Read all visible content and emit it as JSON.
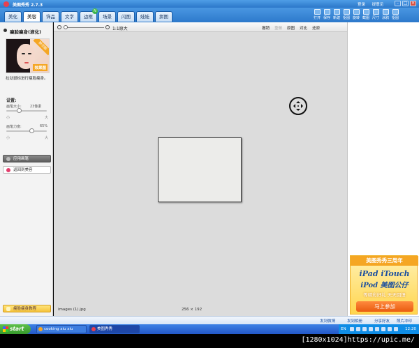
{
  "app": {
    "title": "美图秀秀 2.7.3",
    "links": [
      "登录",
      "提意见"
    ]
  },
  "tabs": [
    {
      "label": "美化"
    },
    {
      "label": "美容",
      "active": true
    },
    {
      "label": "饰品"
    },
    {
      "label": "文字"
    },
    {
      "label": "边框",
      "badge": "N"
    },
    {
      "label": "场景"
    },
    {
      "label": "闪图"
    },
    {
      "label": "娃娃"
    },
    {
      "label": "拼图"
    }
  ],
  "tools": [
    {
      "label": "打开"
    },
    {
      "label": "保存"
    },
    {
      "label": "新建"
    },
    {
      "label": "抠图"
    },
    {
      "label": "旋转"
    },
    {
      "label": "截图"
    },
    {
      "label": "尺寸"
    },
    {
      "label": "涂鸦"
    },
    {
      "label": "抠图"
    }
  ],
  "panel": {
    "title": "瘦脸瘦身(液化)",
    "thumb_corner": "新功能",
    "thumb_label": "效果图",
    "hint": "拉动鼠标进行瘦脸瘦身。",
    "settings_label": "设置:",
    "brush_size": {
      "label": "画笔大小:",
      "value": "23像素",
      "min": "小",
      "max": "大",
      "level": 0.3
    },
    "brush_force": {
      "label": "画笔力度:",
      "value": "65%",
      "min": "小",
      "max": "大",
      "level": 0.65
    },
    "apply_label": "应用画笔",
    "back_label": "返回到美容",
    "tutorial_label": "瘦脸瘦身教程"
  },
  "toolbar": {
    "zoom_label": "1:1原大",
    "undo": "撤销",
    "redo": "重做",
    "original": "原图",
    "compare": "对比",
    "reset": "还原"
  },
  "status": {
    "filename": "images (1).jpg",
    "dimensions": "256 × 192"
  },
  "ad": {
    "header": "美图秀秀三周年",
    "line1": "iPad iTouch",
    "line2": "iPod 美图公仔",
    "line3": "等精彩好礼 天天回馈",
    "button": "马上参加"
  },
  "bottom_strip": {
    "items": [
      "发到微博",
      "发到相册",
      "分享好友",
      "照片冲印"
    ]
  },
  "taskbar": {
    "start": "start",
    "items": [
      "cooking xiu xiu vietfiu...",
      "美图秀秀"
    ],
    "lang": "EN",
    "time": "12:20"
  },
  "footer": {
    "text": "[1280x1024]https://upic.me/"
  }
}
